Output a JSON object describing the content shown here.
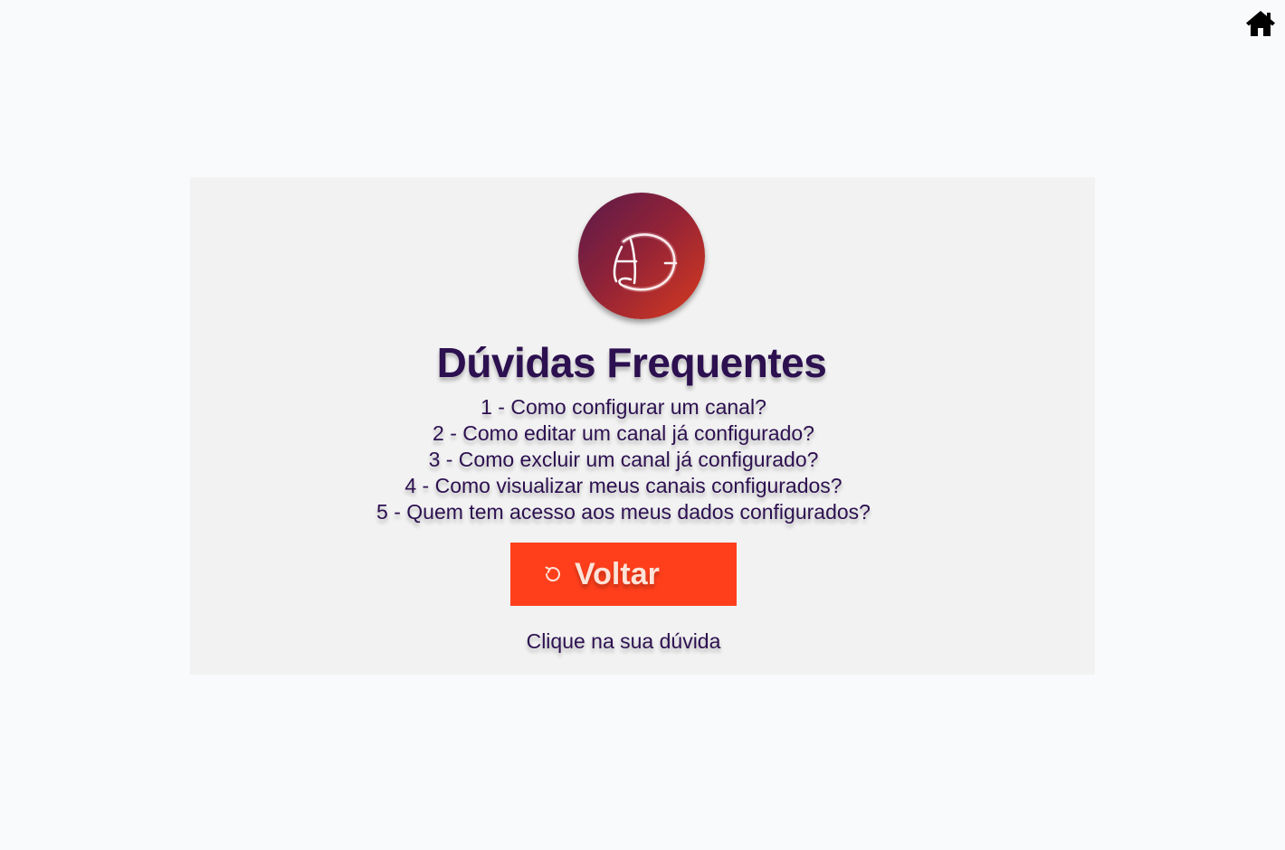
{
  "header": {
    "home_icon": "home-icon"
  },
  "card": {
    "logo_icon": "d-neon-logo",
    "title": "Dúvidas Frequentes",
    "faq_items": [
      "1 - Como configurar um canal?",
      "2 - Como editar um canal já configurado?",
      "3 - Como excluir um canal já configurado?",
      "4 - Como visualizar meus canais configurados?",
      "5 - Quem tem acesso aos meus dados configurados?"
    ],
    "back_button": {
      "label": "Voltar",
      "icon": "refresh-icon"
    },
    "hint": "Clique na sua dúvida"
  },
  "colors": {
    "background": "#f9fafc",
    "card": "#f2f2f2",
    "text": "#2c1050",
    "button": "#ff3f1c",
    "button_text": "#fde3d8"
  }
}
